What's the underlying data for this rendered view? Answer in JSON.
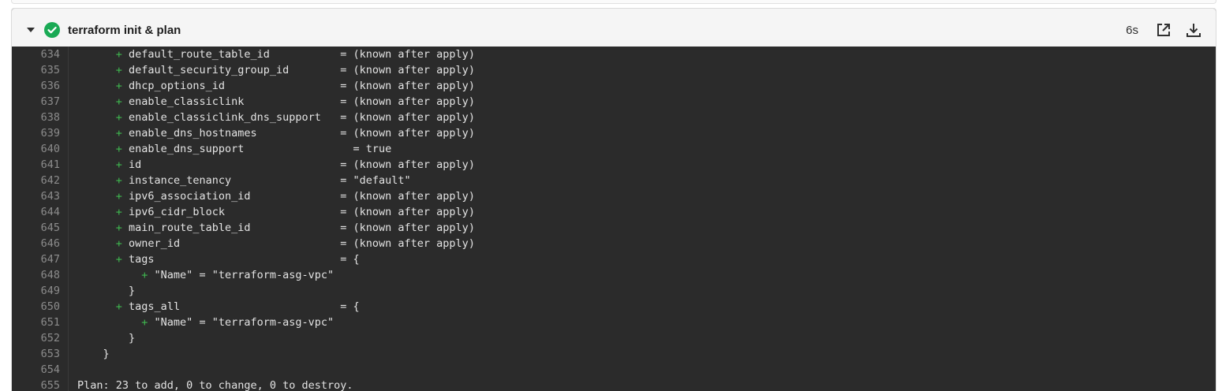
{
  "job": {
    "title": "terraform init & plan",
    "duration": "6s",
    "status": "passed",
    "accent_color": "#1aaa55"
  },
  "icons": {
    "status": "check-circle-icon",
    "expand": "chevron-down-icon",
    "open": "external-link-icon",
    "download": "download-icon"
  },
  "log_lines": [
    {
      "n": "634",
      "indent": "      ",
      "plus": "+ ",
      "text": "default_route_table_id           = (known after apply)"
    },
    {
      "n": "635",
      "indent": "      ",
      "plus": "+ ",
      "text": "default_security_group_id        = (known after apply)"
    },
    {
      "n": "636",
      "indent": "      ",
      "plus": "+ ",
      "text": "dhcp_options_id                  = (known after apply)"
    },
    {
      "n": "637",
      "indent": "      ",
      "plus": "+ ",
      "text": "enable_classiclink               = (known after apply)"
    },
    {
      "n": "638",
      "indent": "      ",
      "plus": "+ ",
      "text": "enable_classiclink_dns_support   = (known after apply)"
    },
    {
      "n": "639",
      "indent": "      ",
      "plus": "+ ",
      "text": "enable_dns_hostnames             = (known after apply)"
    },
    {
      "n": "640",
      "indent": "      ",
      "plus": "+ ",
      "text": "enable_dns_support                 = true"
    },
    {
      "n": "641",
      "indent": "      ",
      "plus": "+ ",
      "text": "id                               = (known after apply)"
    },
    {
      "n": "642",
      "indent": "      ",
      "plus": "+ ",
      "text": "instance_tenancy                 = \"default\""
    },
    {
      "n": "643",
      "indent": "      ",
      "plus": "+ ",
      "text": "ipv6_association_id              = (known after apply)"
    },
    {
      "n": "644",
      "indent": "      ",
      "plus": "+ ",
      "text": "ipv6_cidr_block                  = (known after apply)"
    },
    {
      "n": "645",
      "indent": "      ",
      "plus": "+ ",
      "text": "main_route_table_id              = (known after apply)"
    },
    {
      "n": "646",
      "indent": "      ",
      "plus": "+ ",
      "text": "owner_id                         = (known after apply)"
    },
    {
      "n": "647",
      "indent": "      ",
      "plus": "+ ",
      "text": "tags                             = {"
    },
    {
      "n": "648",
      "indent": "          ",
      "plus": "+ ",
      "text": "\"Name\" = \"terraform-asg-vpc\""
    },
    {
      "n": "649",
      "indent": "        ",
      "plus": "",
      "text": "}"
    },
    {
      "n": "650",
      "indent": "      ",
      "plus": "+ ",
      "text": "tags_all                         = {"
    },
    {
      "n": "651",
      "indent": "          ",
      "plus": "+ ",
      "text": "\"Name\" = \"terraform-asg-vpc\""
    },
    {
      "n": "652",
      "indent": "        ",
      "plus": "",
      "text": "}"
    },
    {
      "n": "653",
      "indent": "    ",
      "plus": "",
      "text": "}"
    },
    {
      "n": "654",
      "indent": "",
      "plus": "",
      "text": ""
    },
    {
      "n": "655",
      "indent": "",
      "plus": "",
      "text": "Plan: 23 to add, 0 to change, 0 to destroy."
    }
  ]
}
